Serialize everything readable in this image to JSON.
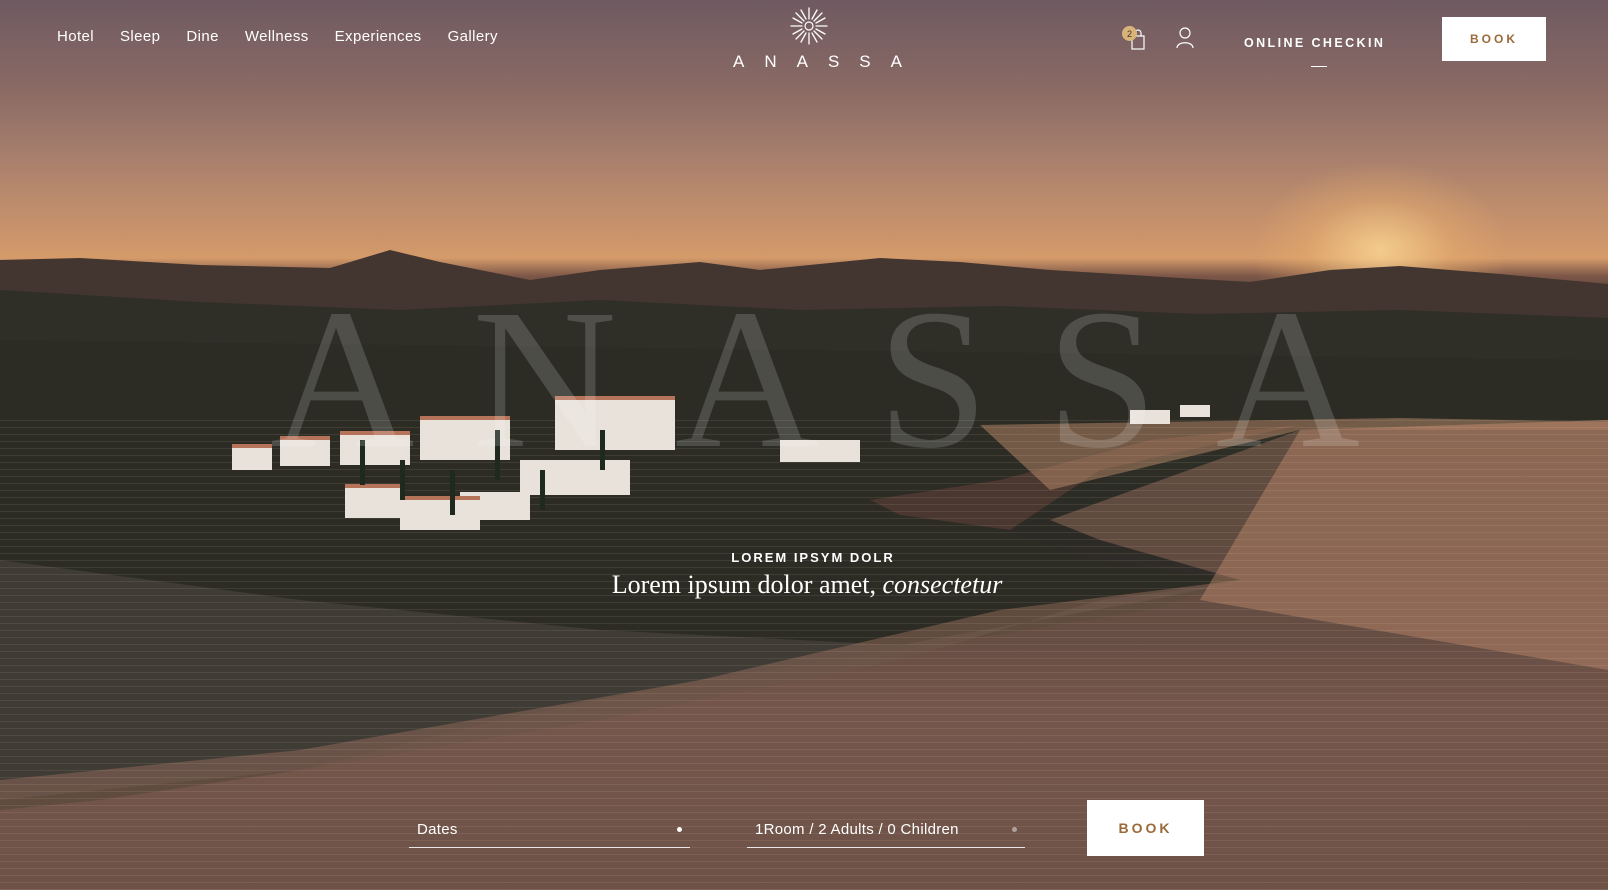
{
  "nav": {
    "items": [
      {
        "label": "Hotel"
      },
      {
        "label": "Sleep"
      },
      {
        "label": "Dine"
      },
      {
        "label": "Wellness"
      },
      {
        "label": "Experiences"
      },
      {
        "label": "Gallery"
      }
    ]
  },
  "logo": {
    "text": "ANASSA",
    "icon": "sun-burst-icon"
  },
  "cart": {
    "count": "2",
    "icon": "shopping-bag-icon"
  },
  "account": {
    "icon": "user-icon"
  },
  "checkin": {
    "label": "ONLINE CHECKIN"
  },
  "header_book": {
    "label": "BOOK"
  },
  "watermark": {
    "letters": [
      "A",
      "N",
      "A",
      "S",
      "S",
      "A"
    ]
  },
  "hero": {
    "kicker": "LOREM IPSYM DOLR",
    "headline": "Lorem ipsum dolor  amet,",
    "headline_italic": "consectetur"
  },
  "booking": {
    "dates_value": "Dates",
    "guests_value": "1Room / 2 Adults / 0 Children",
    "book_label": "BOOK"
  },
  "colors": {
    "accent": "#9a6a3a",
    "badge": "#d8b47a"
  }
}
